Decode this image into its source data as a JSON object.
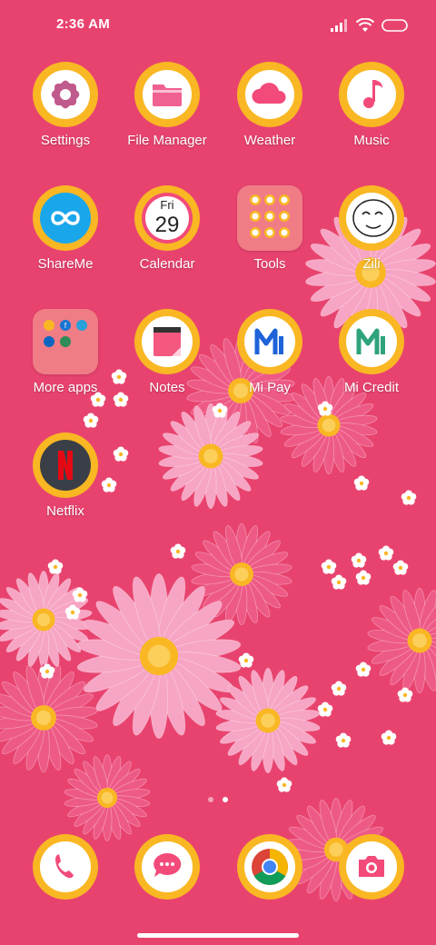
{
  "status": {
    "time": "2:36 AM"
  },
  "apps": {
    "settings": "Settings",
    "file_manager": "File Manager",
    "weather": "Weather",
    "music": "Music",
    "shareme": "ShareMe",
    "calendar": "Calendar",
    "calendar_day": "Fri",
    "calendar_date": "29",
    "tools": "Tools",
    "zili": "Zili",
    "more_apps": "More apps",
    "notes": "Notes",
    "mi_pay": "Mi Pay",
    "mi_credit": "Mi Credit",
    "netflix": "Netflix"
  },
  "dock": [
    "phone-icon",
    "messages-icon",
    "chrome-icon",
    "camera-icon"
  ],
  "pager": {
    "pages": 2,
    "current": 2
  },
  "colors": {
    "wallpaper": "#e8436f",
    "badge_ring": "#f9b723",
    "accent": "#ef3d6e"
  }
}
